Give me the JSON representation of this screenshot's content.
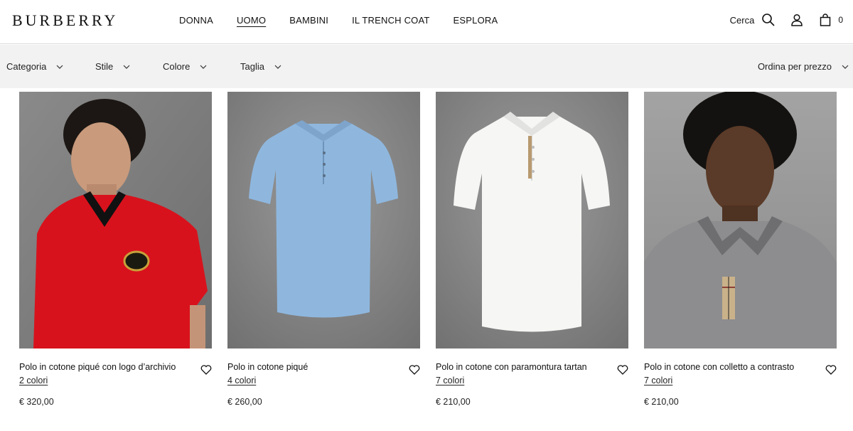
{
  "header": {
    "logo": "BURBERRY",
    "nav": [
      "DONNA",
      "UOMO",
      "BAMBINI",
      "IL TRENCH COAT",
      "ESPLORA"
    ],
    "active_nav": "UOMO",
    "search_label": "Cerca",
    "bag_count": "0",
    "icons": [
      "search-icon",
      "account-icon",
      "bag-icon"
    ]
  },
  "filters": {
    "category": "Categoria",
    "style": "Stile",
    "color": "Colore",
    "size": "Taglia",
    "sort": "Ordina per prezzo"
  },
  "products": [
    {
      "name": "Polo in cotone piqué con logo d’archivio",
      "colors": "2 colori",
      "price": "€ 320,00",
      "shirt_color": "#d8121c"
    },
    {
      "name": "Polo in cotone piqué",
      "colors": "4 colori",
      "price": "€ 260,00",
      "shirt_color": "#8fb7de"
    },
    {
      "name": "Polo in cotone con paramontura tartan",
      "colors": "7 colori",
      "price": "€ 210,00",
      "shirt_color": "#f6f6f4"
    },
    {
      "name": "Polo in cotone con colletto a contrasto",
      "colors": "7 colori",
      "price": "€ 210,00",
      "shirt_color": "#8d8d8f"
    }
  ]
}
